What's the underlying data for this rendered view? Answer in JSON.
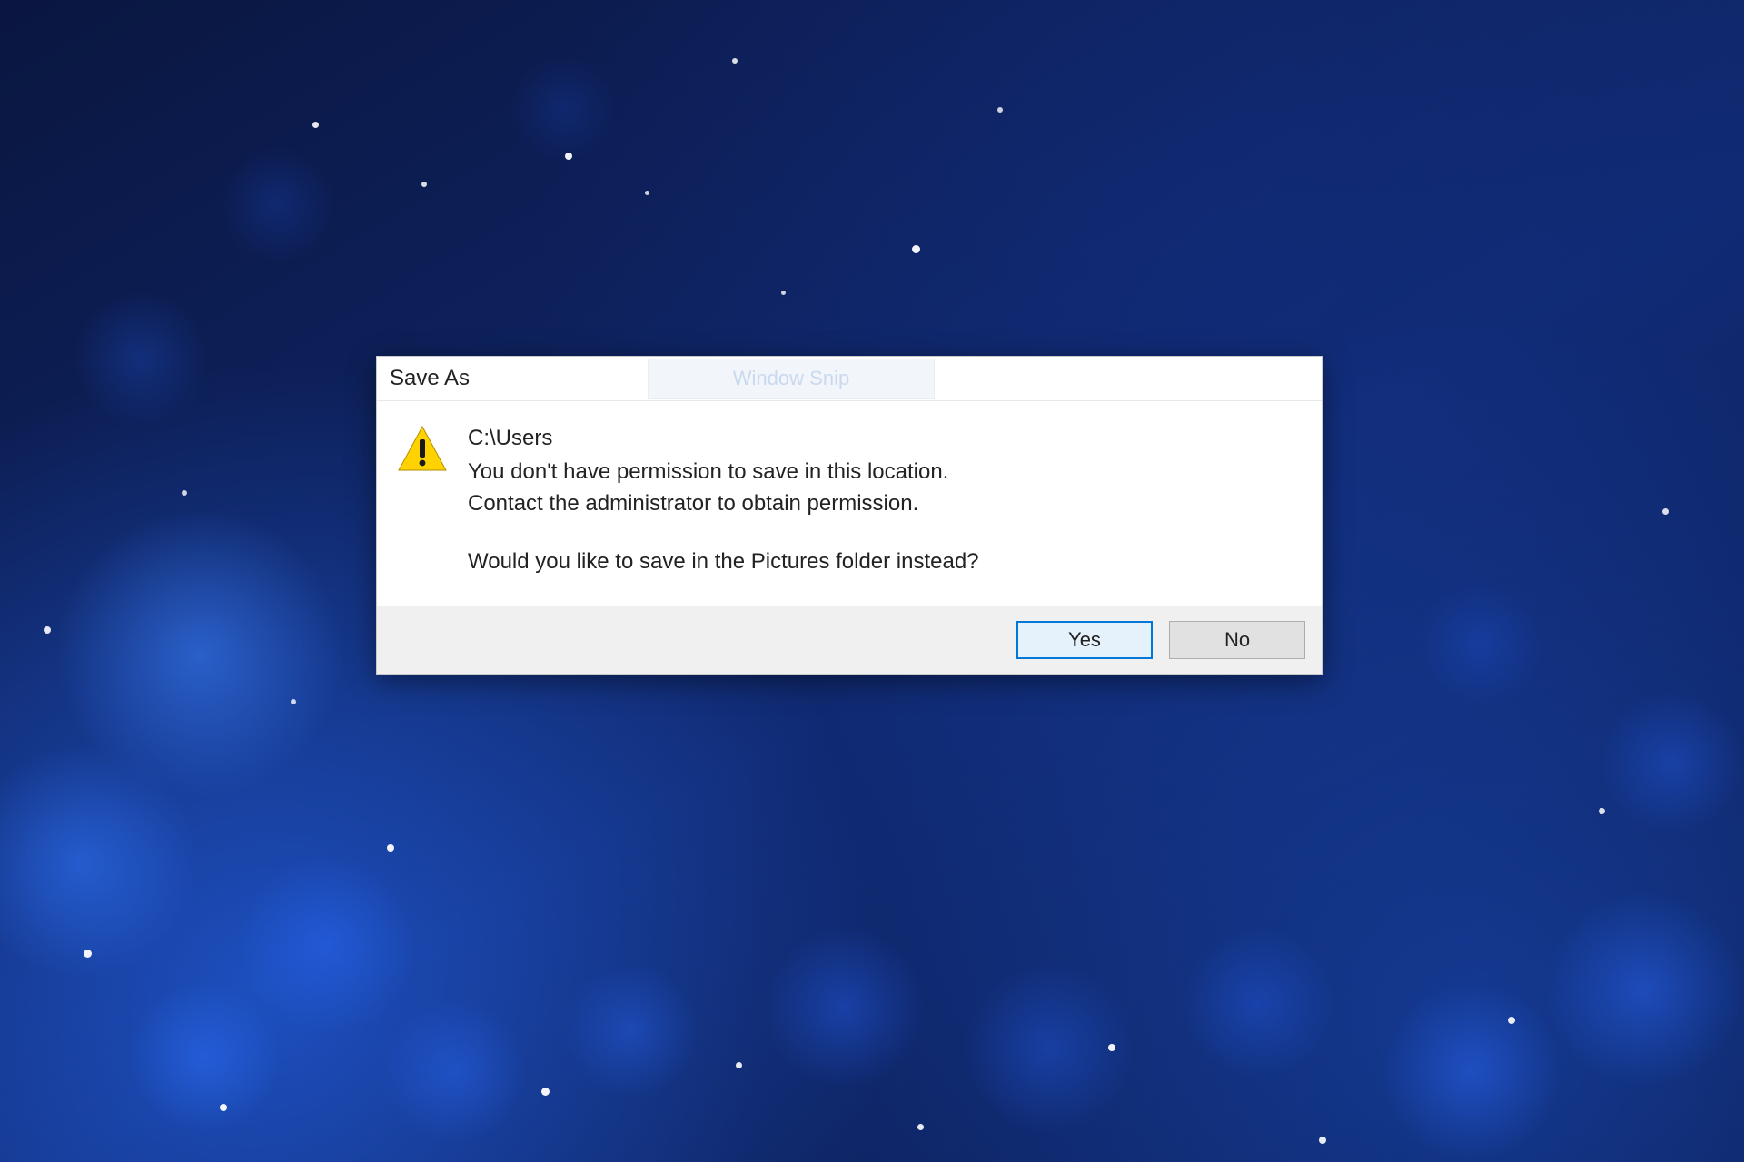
{
  "dialog": {
    "title": "Save As",
    "ghost_overlay_label": "Window Snip",
    "message": {
      "path": "C:\\Users",
      "line1": "You don't have permission to save in this location.",
      "line2": "Contact the administrator to obtain permission.",
      "line3": "Would you like to save in the Pictures folder instead?"
    },
    "buttons": {
      "yes": "Yes",
      "no": "No"
    }
  }
}
